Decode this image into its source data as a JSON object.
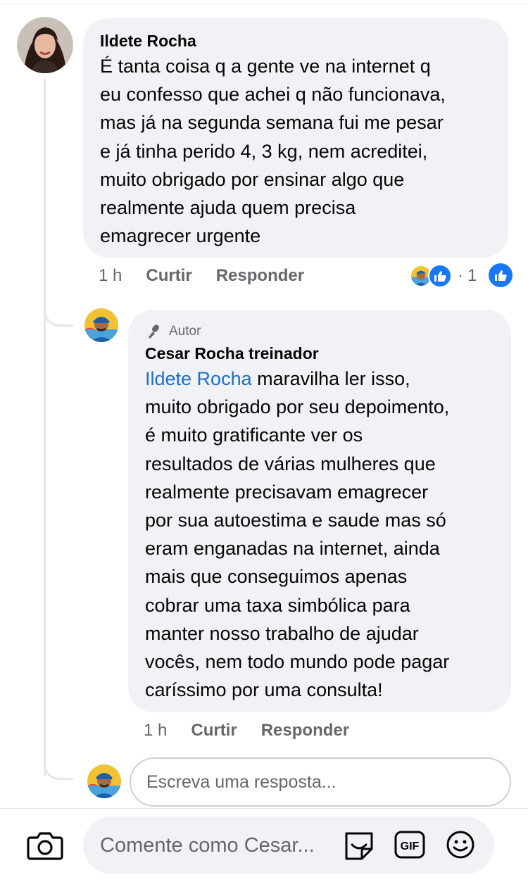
{
  "comment": {
    "author": "Ildete Rocha",
    "lines": [
      "É tanta coisa q a gente ve na internet q",
      "eu confesso que achei q não funcionava,",
      "mas já na segunda semana fui me pesar",
      "e já tinha perido 4, 3 kg, nem acreditei,",
      "muito obrigado por ensinar algo que",
      "realmente ajuda quem precisa",
      "emagrecer urgente"
    ],
    "time": "1 h",
    "like_label": "Curtir",
    "reply_label": "Responder",
    "reaction_separator": "·",
    "reaction_count": "1"
  },
  "reply": {
    "badge_label": "Autor",
    "author": "Cesar Rocha treinador",
    "mention": "Ildete Rocha",
    "first_line_rest": " maravilha ler isso,",
    "lines": [
      "muito obrigado por seu depoimento,",
      "é muito gratificante ver os",
      "resultados de várias mulheres que",
      "realmente precisavam emagrecer",
      "por sua autoestima e saude mas só",
      "eram enganadas na internet, ainda",
      "mais que conseguimos apenas",
      "cobrar uma taxa simbólica para",
      "manter nosso trabalho de ajudar",
      "vocês, nem todo mundo pode pagar",
      "caríssimo por uma consulta!"
    ],
    "time": "1 h",
    "like_label": "Curtir",
    "reply_label": "Responder"
  },
  "reply_box": {
    "placeholder": "Escreva uma resposta..."
  },
  "comment_bar": {
    "placeholder": "Comente como Cesar...",
    "icons": [
      "camera-icon",
      "sticker-icon",
      "gif-icon",
      "emoji-icon"
    ],
    "gif_text": "GIF"
  },
  "colors": {
    "like_blue": "#1877f2",
    "mention_blue": "#1c6fd1",
    "bubble": "#f0f2f5",
    "secondary_text": "#65676b"
  }
}
